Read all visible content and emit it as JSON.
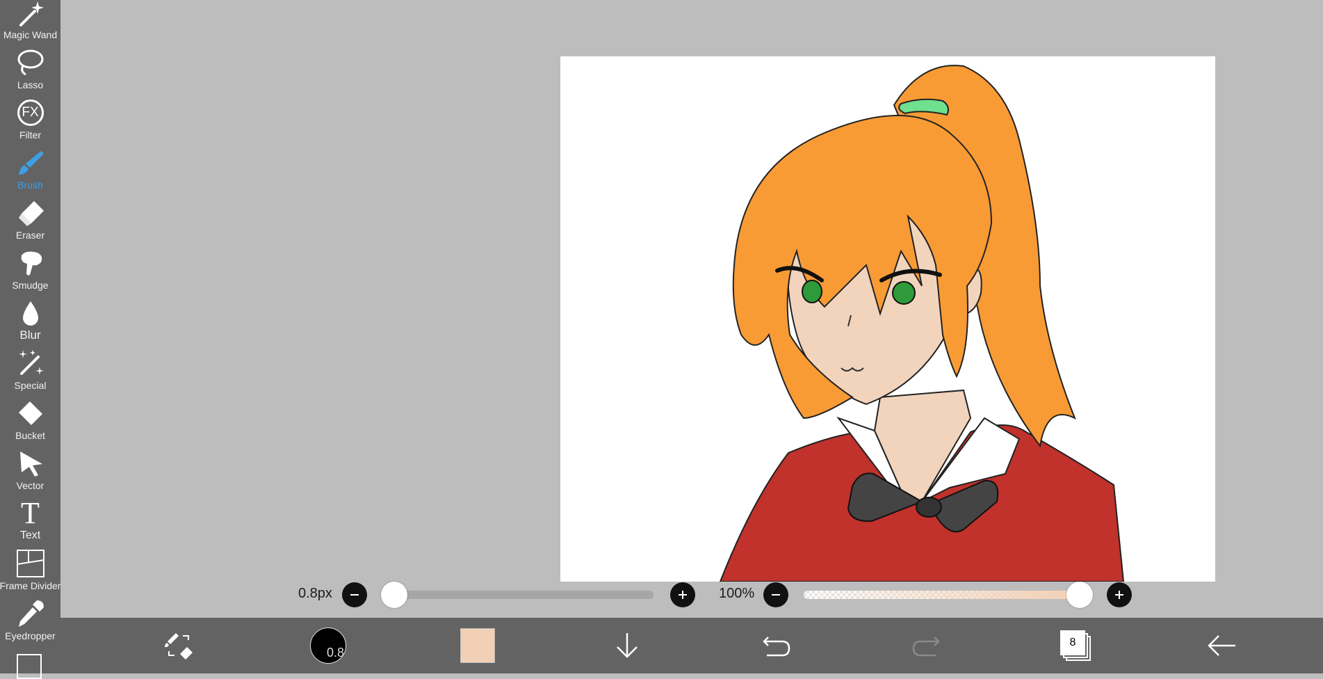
{
  "toolbar": {
    "tools": [
      {
        "label": "Magic Wand",
        "icon": "magic-wand-icon"
      },
      {
        "label": "Lasso",
        "icon": "lasso-icon"
      },
      {
        "label": "Filter",
        "icon": "fx-icon",
        "icon_text": "FX"
      },
      {
        "label": "Brush",
        "icon": "brush-icon",
        "active": true
      },
      {
        "label": "Eraser",
        "icon": "eraser-icon"
      },
      {
        "label": "Smudge",
        "icon": "smudge-icon"
      },
      {
        "label": "Blur",
        "icon": "blur-drop-icon"
      },
      {
        "label": "Special",
        "icon": "special-brush-icon"
      },
      {
        "label": "Bucket",
        "icon": "bucket-icon"
      },
      {
        "label": "Vector",
        "icon": "vector-arrow-icon"
      },
      {
        "label": "Text",
        "icon": "text-icon",
        "icon_text": "T"
      },
      {
        "label": "Frame Divider",
        "icon": "frame-divider-icon"
      },
      {
        "label": "Eyedropper",
        "icon": "eyedropper-icon"
      }
    ],
    "active_color": "#3d9fe6"
  },
  "brush_size": {
    "value_label": "0.8px",
    "level": 0.0
  },
  "opacity": {
    "value_label": "100%",
    "level": 1.0
  },
  "bottom_bar": {
    "brush_preview_label": "0.8",
    "current_color": "#f2d0b5",
    "layers_count": "8",
    "icons": [
      "swap-brush-eraser-icon",
      "brush-size-preview",
      "color-swatch",
      "download-arrow-icon",
      "undo-icon",
      "redo-icon",
      "layers-icon",
      "back-arrow-icon"
    ]
  },
  "colors": {
    "workspace_bg": "#bdbdbd",
    "toolbar_bg": "#636363",
    "canvas_bg": "#ffffff",
    "hair": "#f89b35",
    "skin": "#f2d4bd",
    "uniform": "#c0322b",
    "eyes": "#2f9a3a",
    "hair_tie": "#6fe08e",
    "bow": "#444444"
  }
}
